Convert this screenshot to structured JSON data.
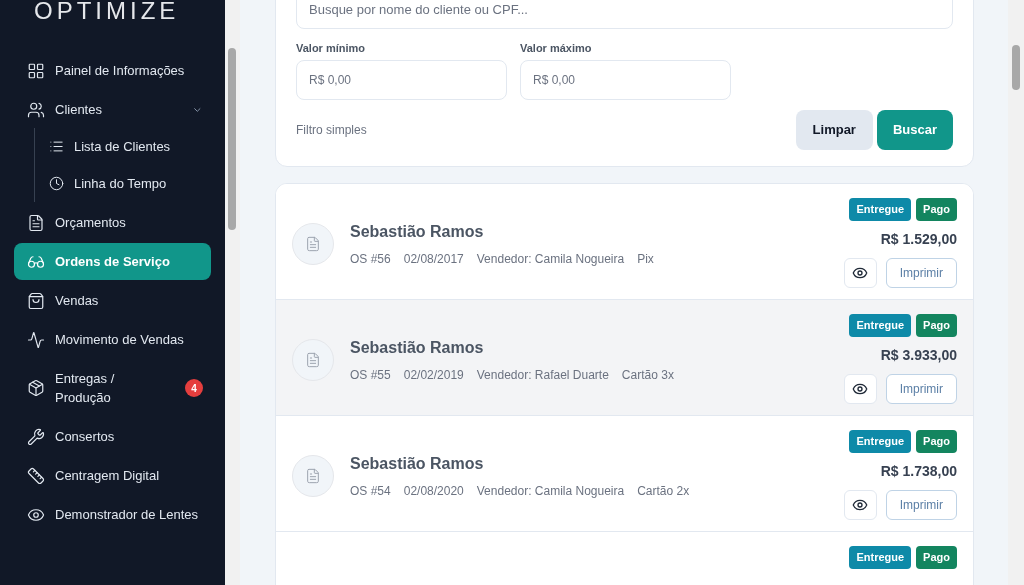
{
  "sidebar": {
    "logo": "OPTIMIZE",
    "items": [
      {
        "kind": "item",
        "label": "Painel de Informações",
        "selected": false
      },
      {
        "kind": "group",
        "label": "Clientes",
        "expanded": true,
        "selected": false,
        "children": [
          {
            "label": "Lista de Clientes",
            "selected": false
          },
          {
            "label": "Linha do Tempo",
            "selected": false
          }
        ]
      },
      {
        "kind": "item",
        "label": "Orçamentos",
        "selected": false
      },
      {
        "kind": "item",
        "label": "Ordens de Serviço",
        "selected": true
      },
      {
        "kind": "item",
        "label": "Vendas",
        "selected": false
      },
      {
        "kind": "item",
        "label": "Movimento de Vendas",
        "selected": false
      },
      {
        "kind": "item",
        "label": "Entregas / Produção",
        "badge": "4",
        "selected": false
      },
      {
        "kind": "item",
        "label": "Consertos",
        "selected": false
      },
      {
        "kind": "item",
        "label": "Centragem Digital",
        "selected": false
      },
      {
        "kind": "item",
        "label": "Demonstrador de Lentes",
        "selected": false
      }
    ]
  },
  "filters": {
    "search": {
      "placeholder": "Busque por nome do cliente ou CPF..."
    },
    "min": {
      "label": "Valor mínimo",
      "placeholder": "R$ 0,00"
    },
    "max": {
      "label": "Valor máximo",
      "placeholder": "R$ 0,00"
    },
    "mode": "Filtro simples",
    "clear": "Limpar",
    "submit": "Buscar"
  },
  "orders": [
    {
      "client": "Sebastião Ramos",
      "number": "OS #56",
      "date": "02/08/2017",
      "seller": "Vendedor: Camila Nogueira",
      "payment": "Pix",
      "total": "R$ 1.529,00",
      "print": "Imprimir",
      "hovered": false,
      "statuses": [
        {
          "label": "Entregue",
          "color": "#0e8aa8"
        },
        {
          "label": "Pago",
          "color": "#13855f"
        }
      ]
    },
    {
      "client": "Sebastião Ramos",
      "number": "OS #55",
      "date": "02/02/2019",
      "seller": "Vendedor: Rafael Duarte",
      "payment": "Cartão 3x",
      "total": "R$ 3.933,00",
      "print": "Imprimir",
      "hovered": true,
      "statuses": [
        {
          "label": "Entregue",
          "color": "#0e8aa8"
        },
        {
          "label": "Pago",
          "color": "#13855f"
        }
      ]
    },
    {
      "client": "Sebastião Ramos",
      "number": "OS #54",
      "date": "02/08/2020",
      "seller": "Vendedor: Camila Nogueira",
      "payment": "Cartão 2x",
      "total": "R$ 1.738,00",
      "print": "Imprimir",
      "hovered": false,
      "statuses": [
        {
          "label": "Entregue",
          "color": "#0e8aa8"
        },
        {
          "label": "Pago",
          "color": "#13855f"
        }
      ]
    },
    {
      "hovered": false,
      "statuses": [
        {
          "label": "Entregue",
          "color": "#0e8aa8"
        },
        {
          "label": "Pago",
          "color": "#13855f"
        }
      ]
    }
  ]
}
